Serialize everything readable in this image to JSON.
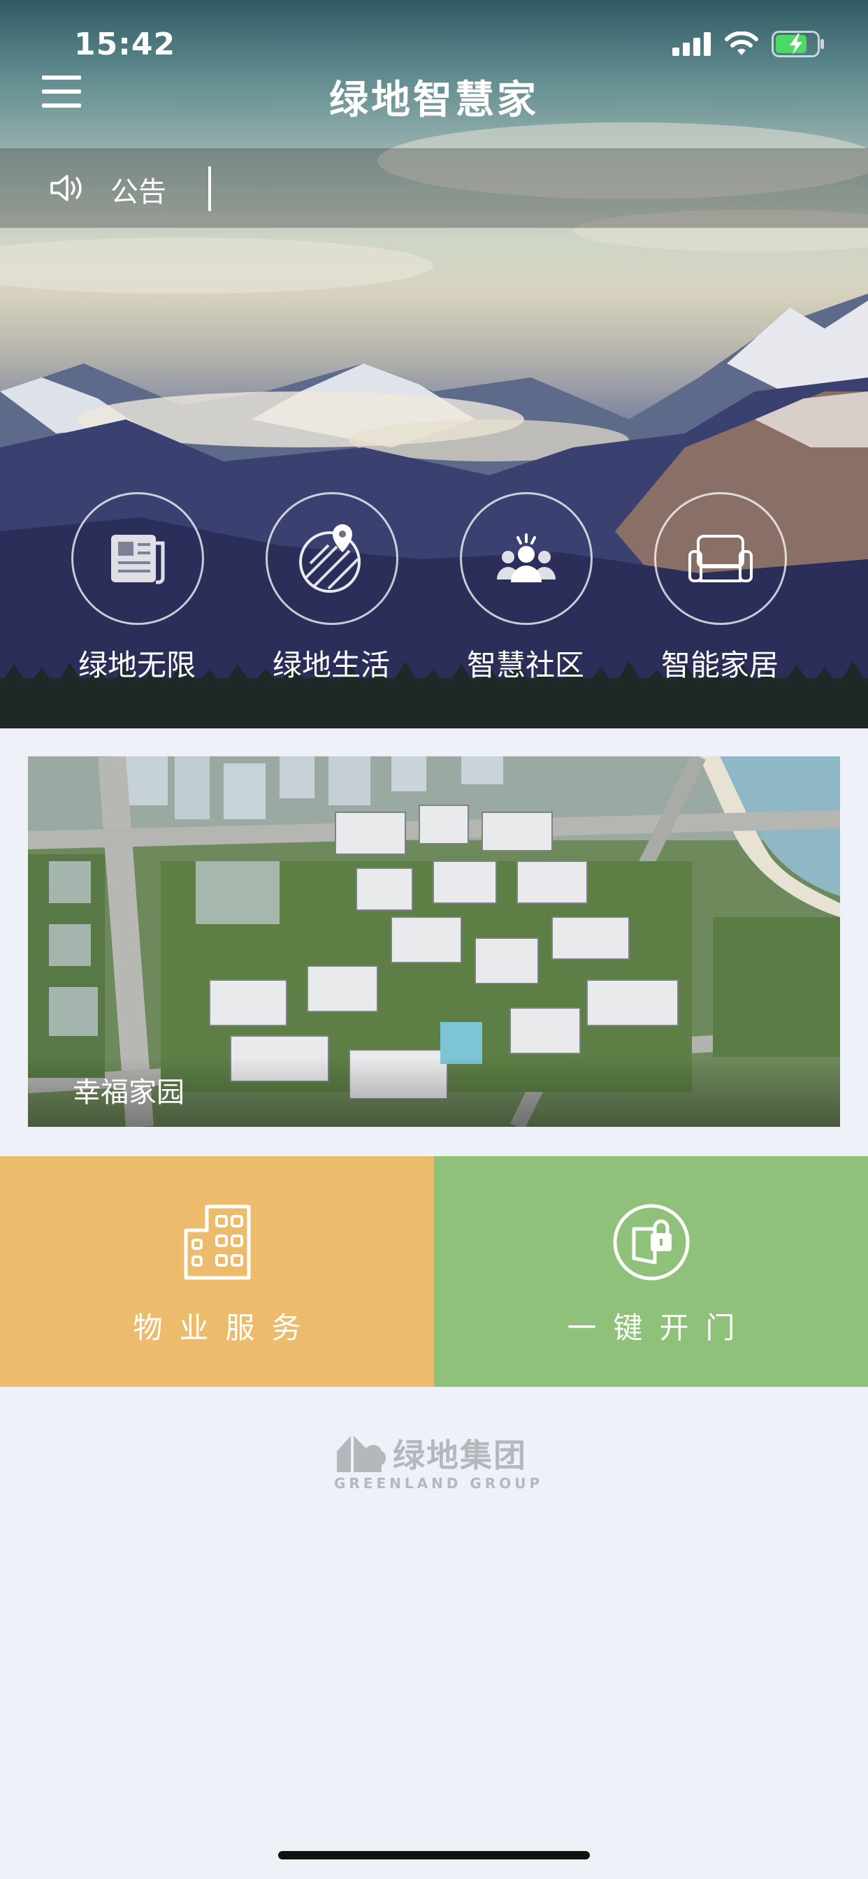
{
  "status_bar": {
    "time": "15:42",
    "icons": [
      "signal-icon",
      "wifi-icon",
      "battery-charging-icon"
    ]
  },
  "header": {
    "title": "绿地智慧家",
    "menu_icon": "hamburger-menu-icon"
  },
  "notice": {
    "icon": "speaker-icon",
    "label": "公告"
  },
  "quick_nav": [
    {
      "label": "绿地无限",
      "icon": "newspaper-icon"
    },
    {
      "label": "绿地生活",
      "icon": "map-pin-icon"
    },
    {
      "label": "智慧社区",
      "icon": "community-people-icon"
    },
    {
      "label": "智能家居",
      "icon": "sofa-icon"
    }
  ],
  "banner": {
    "caption": "幸福家园"
  },
  "tiles": [
    {
      "label": "物业服务",
      "icon": "building-icon",
      "color": "#ecbc6c"
    },
    {
      "label": "一键开门",
      "icon": "door-lock-icon",
      "color": "#90c17a"
    }
  ],
  "footer": {
    "logo_cn": "绿地集团",
    "logo_en": "GREENLAND GROUP"
  }
}
